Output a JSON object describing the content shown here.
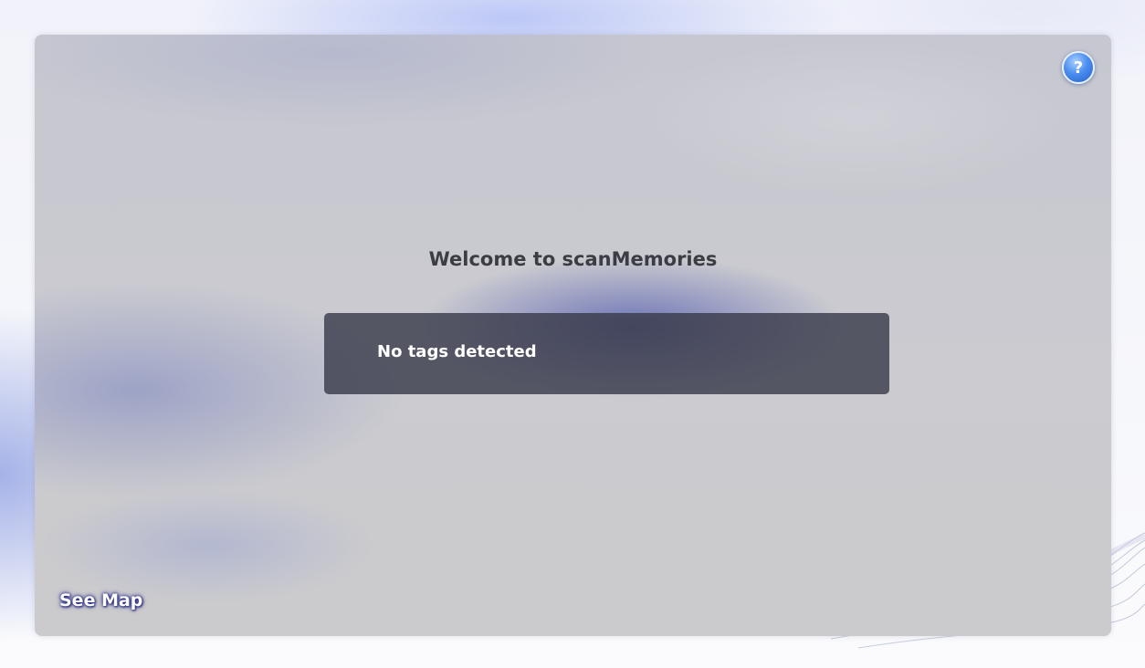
{
  "app": {
    "welcome_title": "Welcome to scanMemories",
    "tags_status": "No tags detected",
    "see_map_label": "See Map",
    "help_label": "?"
  },
  "icons": {
    "help": "help-icon"
  },
  "colors": {
    "panel": "#cbcbd0",
    "status_box": "#3a3c4c",
    "help_button": "#4b8ef0",
    "title_text": "#3c3d44"
  }
}
